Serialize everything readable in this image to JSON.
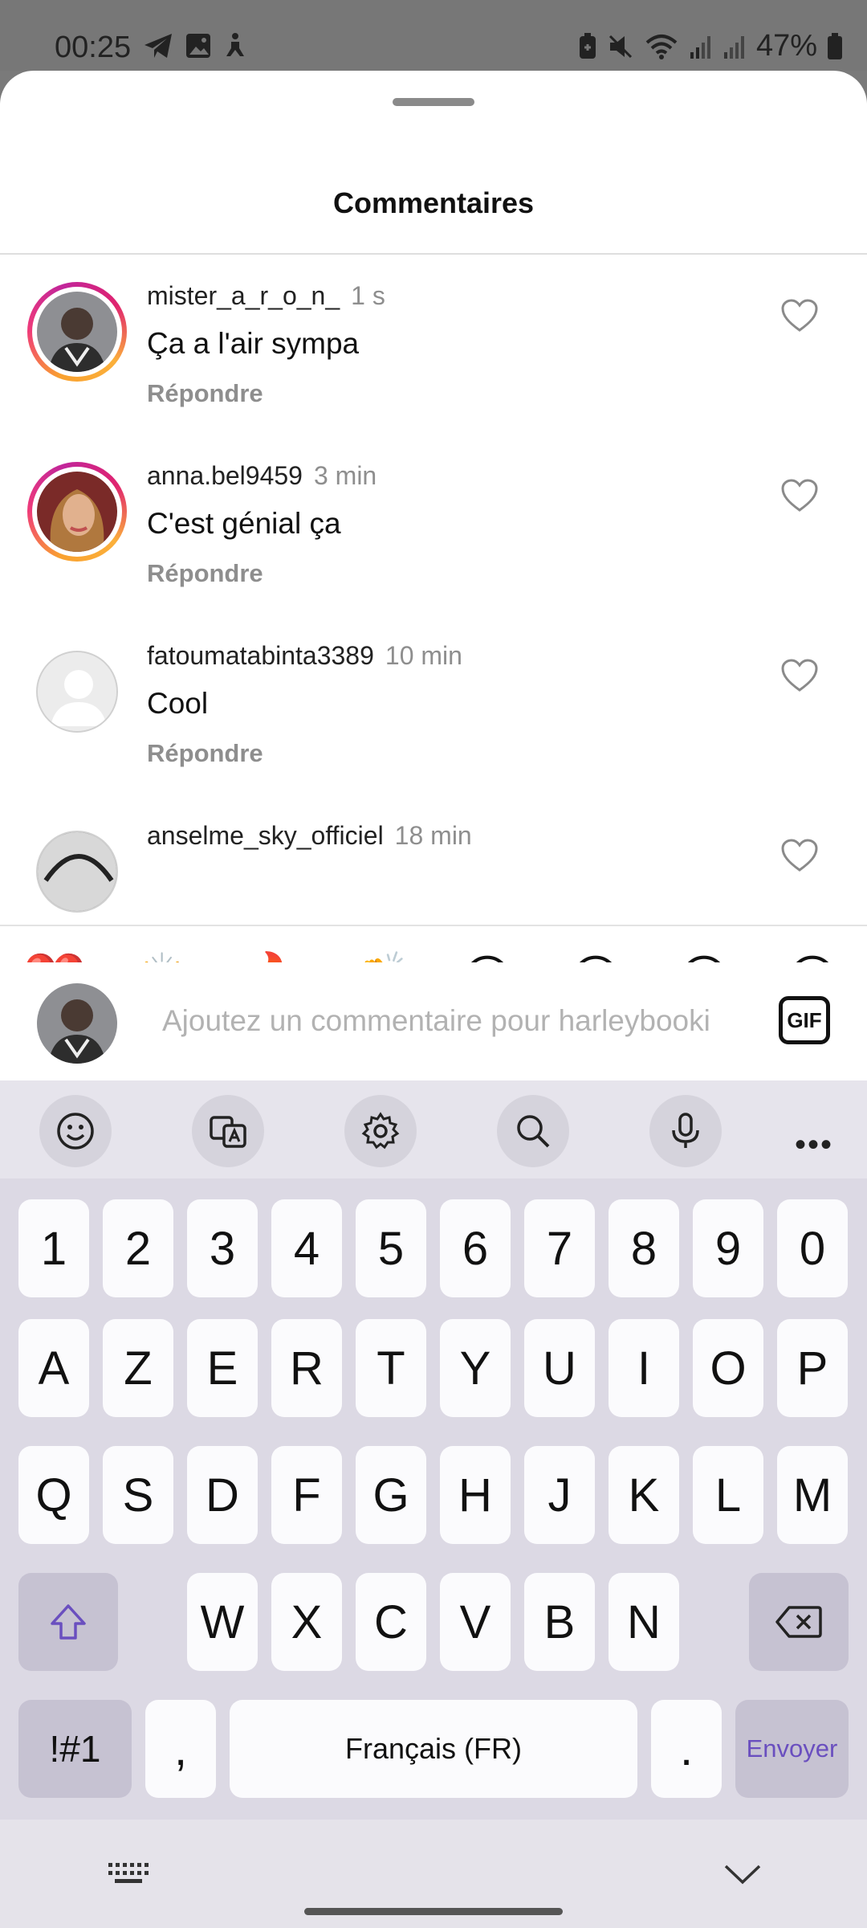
{
  "status": {
    "time": "00:25",
    "battery": "47%",
    "left_icons": [
      "telegram-icon",
      "gallery-icon",
      "accessibility-icon"
    ],
    "right_icons": [
      "battery-saver-icon",
      "mute-icon",
      "wifi-icon",
      "signal-icon",
      "signal-icon"
    ]
  },
  "sheet": {
    "title": "Commentaires"
  },
  "comments": [
    {
      "user": "mister_a_r_o_n_",
      "time": "1 s",
      "text": "Ça a l'air sympa",
      "reply": "Répondre",
      "avatar": "ring"
    },
    {
      "user": "anna.bel9459",
      "time": "3 min",
      "text": "C'est génial ça",
      "reply": "Répondre",
      "avatar": "ring"
    },
    {
      "user": "fatoumatabinta3389",
      "time": "10 min",
      "text": "Cool",
      "reply": "Répondre",
      "avatar": "default"
    },
    {
      "user": "anselme_sky_officiel",
      "time": "18 min",
      "text": "",
      "reply": "",
      "avatar": "plain"
    }
  ],
  "reactions": [
    "❤️",
    "🙌",
    "🔥",
    "👏",
    "😢",
    "😍",
    "😮",
    "😂"
  ],
  "composer": {
    "placeholder": "Ajoutez un commentaire pour harleybooki",
    "gif_label": "GIF"
  },
  "keyboard": {
    "toolbar": [
      "emoji-icon",
      "translate-icon",
      "settings-icon",
      "search-icon",
      "mic-icon",
      "more-icon"
    ],
    "more_label": "•••",
    "row_numbers": [
      "1",
      "2",
      "3",
      "4",
      "5",
      "6",
      "7",
      "8",
      "9",
      "0"
    ],
    "row1": [
      "A",
      "Z",
      "E",
      "R",
      "T",
      "Y",
      "U",
      "I",
      "O",
      "P"
    ],
    "row2": [
      "Q",
      "S",
      "D",
      "F",
      "G",
      "H",
      "J",
      "K",
      "L",
      "M"
    ],
    "row3": [
      "W",
      "X",
      "C",
      "V",
      "B",
      "N"
    ],
    "symbols_label": "!#1",
    "comma": ",",
    "space_label": "Français (FR)",
    "period": ".",
    "send_label": "Envoyer"
  },
  "colors": {
    "accent": "#6a4fbf",
    "keyboard_bg": "#dcd9e4",
    "modifier_key": "#c6c2d2"
  }
}
